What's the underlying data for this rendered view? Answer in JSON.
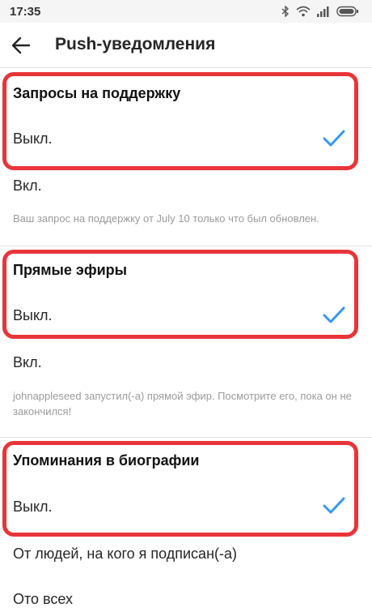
{
  "status_bar": {
    "time": "17:35"
  },
  "header": {
    "title": "Push-уведомления"
  },
  "sections": [
    {
      "title": "Запросы на поддержку",
      "options": [
        "Выкл.",
        "Вкл."
      ],
      "selected": "Выкл.",
      "hint": "Ваш запрос на поддержку от July 10 только что был обновлен."
    },
    {
      "title": "Прямые эфиры",
      "options": [
        "Выкл.",
        "Вкл."
      ],
      "selected": "Выкл.",
      "hint": "johnappleseed запустил(-а) прямой эфир. Посмотрите его, пока он не закончился!"
    },
    {
      "title": "Упоминания в биографии",
      "options": [
        "Выкл.",
        "От людей, на кого я подписан(-а)",
        "Ото всех"
      ],
      "selected": "Выкл."
    }
  ],
  "colors": {
    "highlight": "#e8353a",
    "check": "#3897f0",
    "hint": "#9b9b9b"
  },
  "icons": {
    "back": "arrow-left-icon",
    "check": "checkmark-icon"
  }
}
